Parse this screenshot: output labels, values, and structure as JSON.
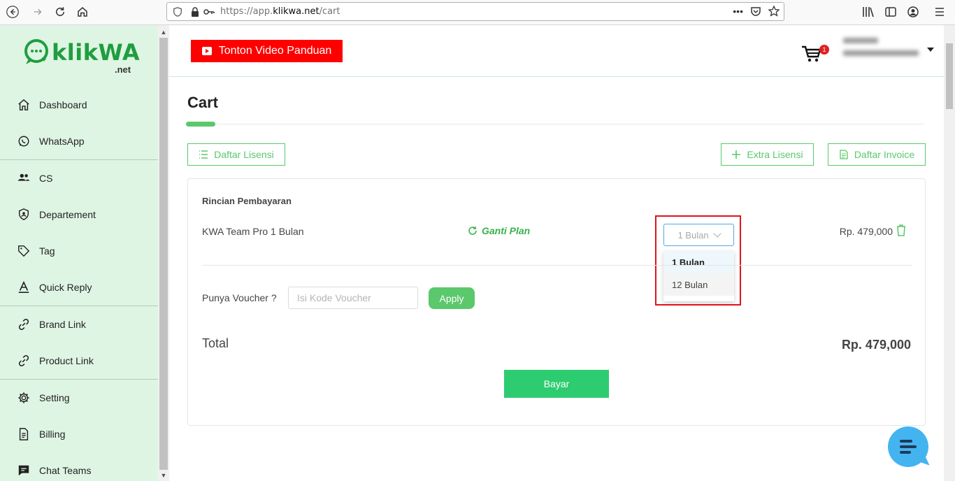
{
  "browser": {
    "url_prefix": "https://app.",
    "url_domain": "klikwa.net",
    "url_path": "/cart",
    "page_actions": "•••"
  },
  "sidebar": {
    "logo_main": "klikWA",
    "logo_sub": ".net",
    "items": [
      {
        "label": "Dashboard",
        "icon": "home-icon"
      },
      {
        "label": "WhatsApp",
        "icon": "whatsapp-icon"
      },
      {
        "label": "CS",
        "icon": "users-icon"
      },
      {
        "label": "Departement",
        "icon": "shield-icon"
      },
      {
        "label": "Tag",
        "icon": "tag-icon"
      },
      {
        "label": "Quick Reply",
        "icon": "font-icon"
      },
      {
        "label": "Brand Link",
        "icon": "link-icon"
      },
      {
        "label": "Product Link",
        "icon": "link-icon"
      },
      {
        "label": "Setting",
        "icon": "gear-icon"
      },
      {
        "label": "Billing",
        "icon": "document-icon"
      },
      {
        "label": "Chat Teams",
        "icon": "chat-icon"
      }
    ]
  },
  "header": {
    "video_button": "Tonton Video Panduan",
    "cart_count": "1"
  },
  "page": {
    "title": "Cart",
    "btn_daftar_lisensi": "Daftar Lisensi",
    "btn_extra_lisensi": "Extra Lisensi",
    "btn_daftar_invoice": "Daftar Invoice"
  },
  "payment": {
    "section_title": "Rincian Pembayaran",
    "product": "KWA Team Pro 1 Bulan",
    "change_plan": "Ganti Plan",
    "plan_selected": "1 Bulan",
    "plan_options": [
      "1 Bulan",
      "12 Bulan"
    ],
    "price": "Rp. 479,000",
    "voucher_label": "Punya Voucher ?",
    "voucher_placeholder": "Isi Kode Voucher",
    "apply_label": "Apply",
    "total_label": "Total",
    "total_value": "Rp. 479,000",
    "pay_label": "Bayar"
  },
  "colors": {
    "accent": "#5ac86b",
    "sidebar_bg": "#dff5e4",
    "video_red": "#ff0000",
    "highlight": "#e0131a",
    "pay_green": "#2ecc71"
  }
}
